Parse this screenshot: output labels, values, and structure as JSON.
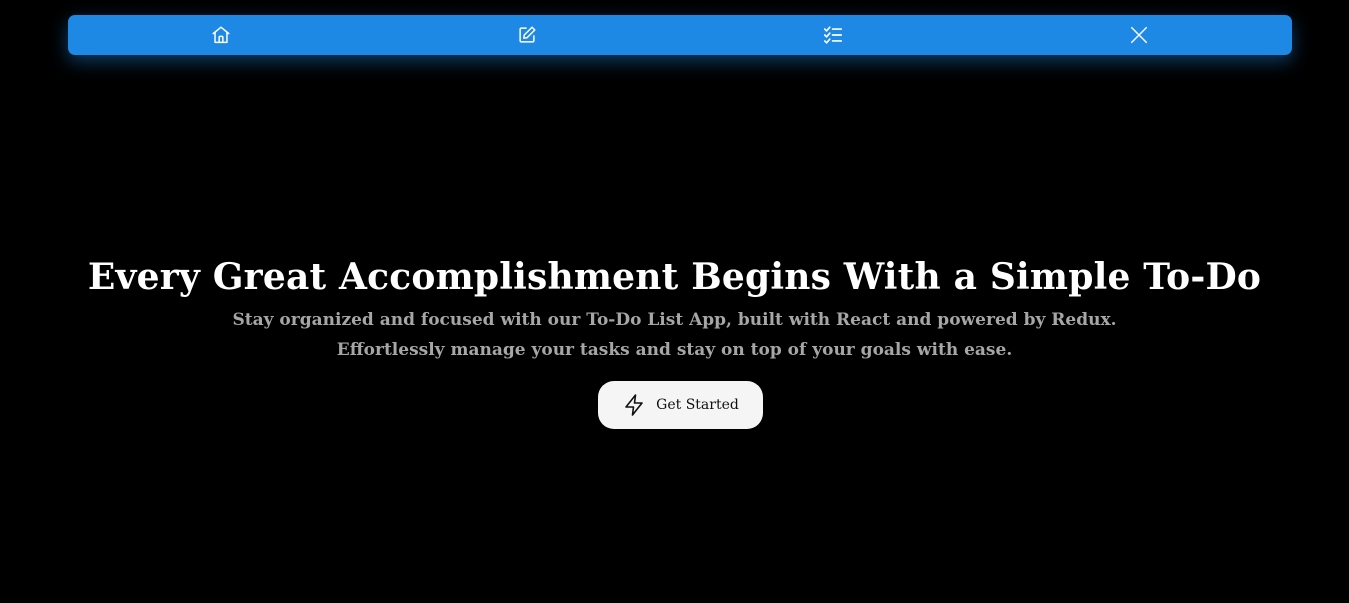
{
  "colors": {
    "navbar_bg": "#1e88e5",
    "nav_icon": "#ffffff",
    "page_bg": "#000000",
    "title": "#ffffff",
    "subtitle": "#a6a6a6",
    "button_bg": "#f5f5f5",
    "button_text": "#111111"
  },
  "navbar": {
    "items": [
      {
        "icon": "home-icon"
      },
      {
        "icon": "edit-icon"
      },
      {
        "icon": "checklist-icon"
      },
      {
        "icon": "close-icon"
      }
    ]
  },
  "hero": {
    "title": "Every Great Accomplishment Begins With a Simple To-Do",
    "subtitle": "Stay organized and focused with our To-Do List App, built with React and powered by Redux. Effortlessly manage your tasks and stay on top of your goals with ease.",
    "cta_label": "Get Started",
    "cta_icon": "lightning-icon"
  }
}
